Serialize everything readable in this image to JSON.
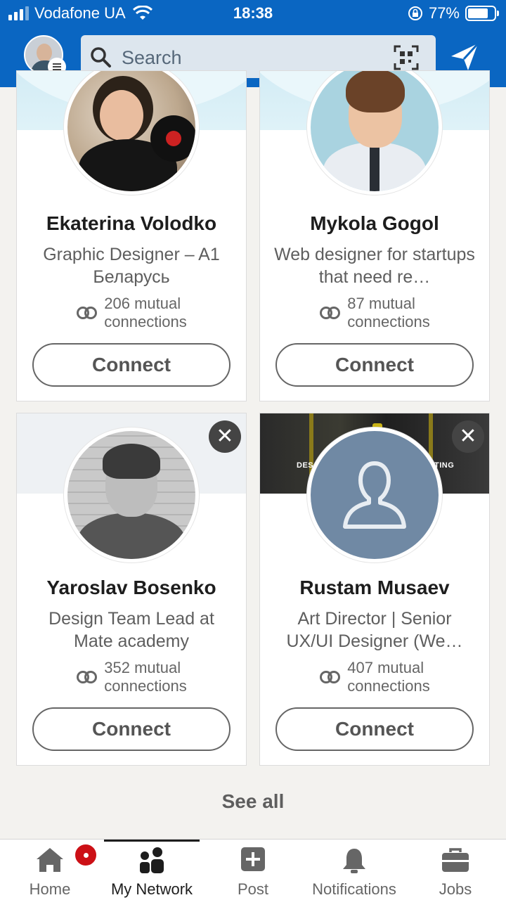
{
  "status_bar": {
    "carrier": "Vodafone UA",
    "time": "18:38",
    "battery": "77%"
  },
  "header": {
    "search_placeholder": "Search"
  },
  "suggestions": [
    {
      "name": "Ekaterina Volodko",
      "headline": "Graphic Designer – A1 Беларусь",
      "mutual_count": "206 mutual",
      "mutual_label": "connections",
      "button": "Connect"
    },
    {
      "name": "Mykola Gogol",
      "headline": "Web designer for startups that need re…",
      "mutual_count": "87 mutual",
      "mutual_label": "connections",
      "button": "Connect"
    },
    {
      "name": "Yaroslav Bosenko",
      "headline": "Design Team Lead at Mate academy",
      "mutual_count": "352 mutual",
      "mutual_label": "connections",
      "button": "Connect"
    },
    {
      "name": "Rustam Musaev",
      "headline": "Art Director | Senior UX/UI Designer (We…",
      "mutual_count": "407 mutual",
      "mutual_label": "connections",
      "button": "Connect"
    }
  ],
  "see_all": "See all",
  "nav": {
    "home": "Home",
    "my_network": "My Network",
    "post": "Post",
    "notifications": "Notifications",
    "jobs": "Jobs"
  },
  "colors": {
    "brand": "#0a66c2",
    "notification": "#cc1016"
  }
}
